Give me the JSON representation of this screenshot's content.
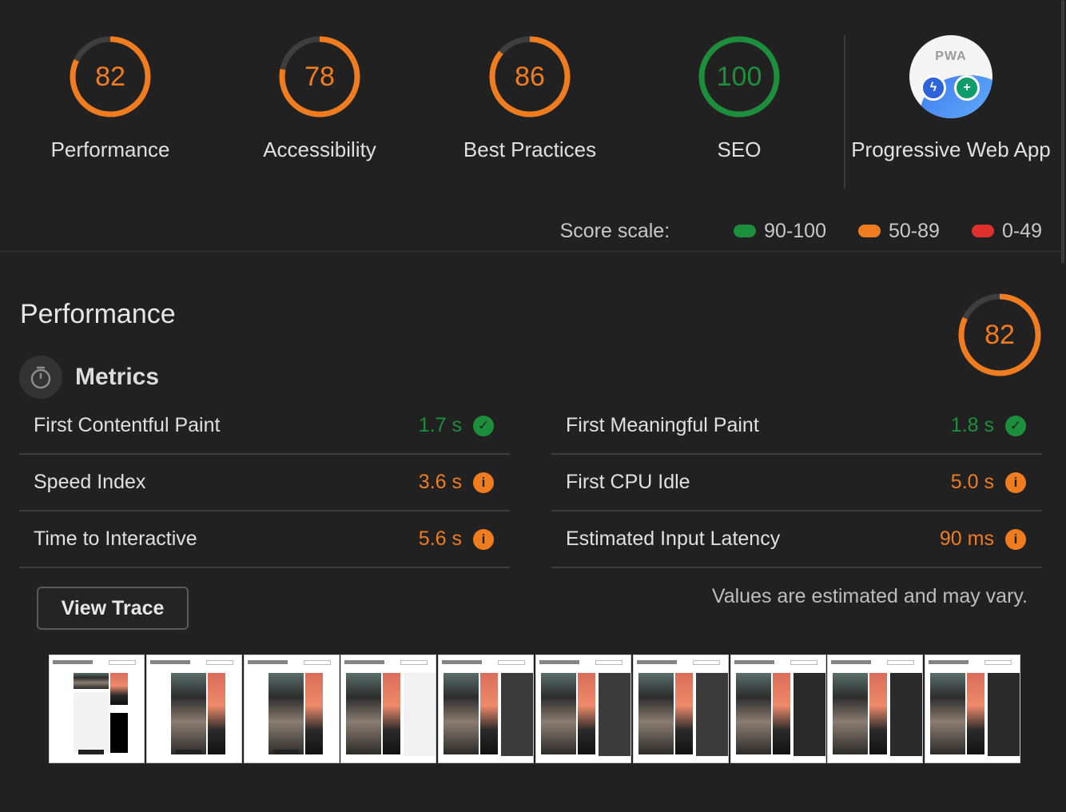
{
  "gauges": [
    {
      "label": "Performance",
      "score": "82",
      "value": 82,
      "color": "#ef7d20"
    },
    {
      "label": "Accessibility",
      "score": "78",
      "value": 78,
      "color": "#ef7d20"
    },
    {
      "label": "Best Practices",
      "score": "86",
      "value": 86,
      "color": "#ef7d20"
    },
    {
      "label": "SEO",
      "score": "100",
      "value": 100,
      "color": "#1d8f3c"
    }
  ],
  "pwa": {
    "label": "Progressive Web App",
    "badge_text": "PWA"
  },
  "score_scale": {
    "label": "Score scale:",
    "ranges": [
      {
        "text": "90-100",
        "color": "#1d8f3c"
      },
      {
        "text": "50-89",
        "color": "#ef7d20"
      },
      {
        "text": "0-49",
        "color": "#e0302b"
      }
    ]
  },
  "performance": {
    "title": "Performance",
    "score": "82",
    "value": 82,
    "metrics_label": "Metrics",
    "metrics_left": [
      {
        "name": "First Contentful Paint",
        "value": "1.7 s",
        "status": "green",
        "icon": "check-icon"
      },
      {
        "name": "Speed Index",
        "value": "3.6 s",
        "status": "orange",
        "icon": "info-icon"
      },
      {
        "name": "Time to Interactive",
        "value": "5.6 s",
        "status": "orange",
        "icon": "info-icon"
      }
    ],
    "metrics_right": [
      {
        "name": "First Meaningful Paint",
        "value": "1.8 s",
        "status": "green",
        "icon": "check-icon"
      },
      {
        "name": "First CPU Idle",
        "value": "5.0 s",
        "status": "orange",
        "icon": "info-icon"
      },
      {
        "name": "Estimated Input Latency",
        "value": "90 ms",
        "status": "orange",
        "icon": "info-icon"
      }
    ],
    "view_trace_label": "View Trace",
    "disclaimer": "Values are estimated and may vary."
  },
  "colors": {
    "background": "#212121",
    "orange": "#ef7d20",
    "green": "#1d8f3c",
    "red": "#e0302b",
    "track": "#3e3e3e"
  }
}
